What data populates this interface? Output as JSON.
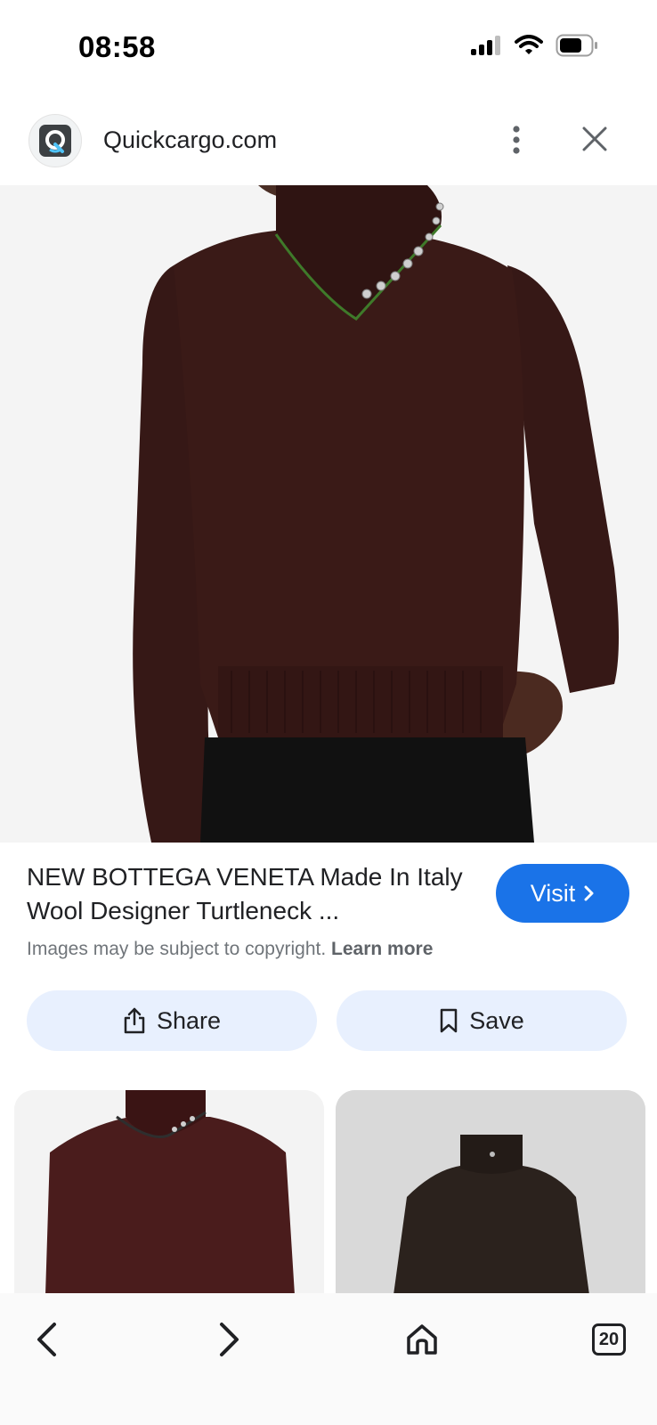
{
  "status_bar": {
    "time": "08:58",
    "icons": [
      "signal-icon",
      "wifi-icon",
      "battery-icon"
    ]
  },
  "header": {
    "site_name": "Quickcargo.com",
    "logo_icon": "quickcargo-logo-icon",
    "menu_icon": "more-vertical-icon",
    "close_icon": "close-icon"
  },
  "hero_image": {
    "subject": "brown knit turtleneck sweater with studded collar"
  },
  "result": {
    "title": "NEW BOTTEGA VENETA Made In Italy Wool Designer Turtleneck ...",
    "copyright_text": "Images may be subject to copyright.",
    "learn_more": "Learn more",
    "visit_label": "Visit"
  },
  "actions": {
    "share_label": "Share",
    "save_label": "Save"
  },
  "related": [
    {
      "subject": "burgundy knit turtleneck sweater"
    },
    {
      "subject": "dark brown knit turtleneck sweater"
    }
  ],
  "bottom_nav": {
    "back_icon": "chevron-left-icon",
    "forward_icon": "chevron-right-icon",
    "home_icon": "home-icon",
    "tab_count": "20"
  },
  "colors": {
    "accent": "#1a73e8",
    "pill_bg": "#e8f0fe",
    "sweater": "#3a1a17"
  }
}
